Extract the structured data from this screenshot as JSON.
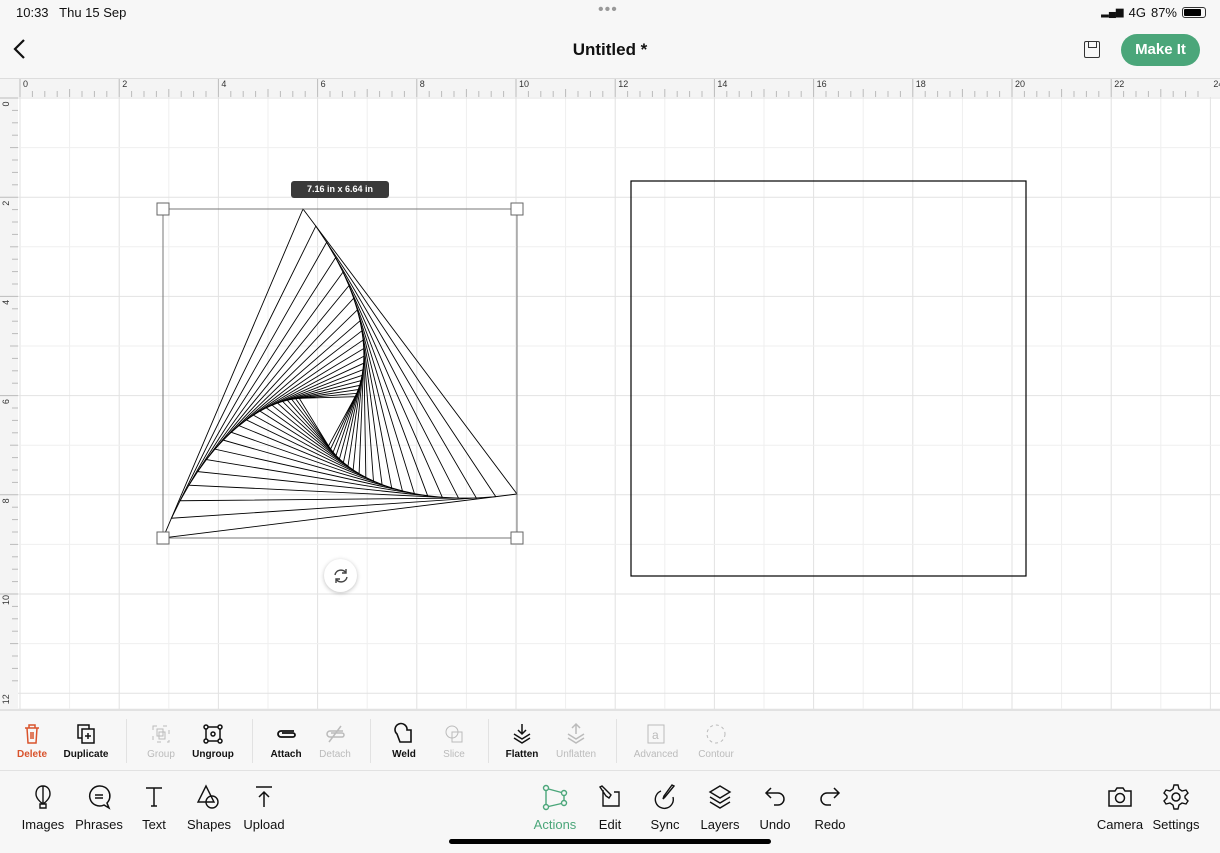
{
  "status_bar": {
    "time": "10:33",
    "date": "Thu 15 Sep",
    "network": "4G",
    "battery": "87%",
    "battery_level": 0.87
  },
  "header": {
    "title": "Untitled *",
    "make_it": "Make It"
  },
  "canvas": {
    "ruler_top": [
      "0",
      "2",
      "4",
      "6",
      "8",
      "10",
      "12",
      "14",
      "16",
      "18",
      "20",
      "22",
      "24"
    ],
    "ruler_left": [
      "0",
      "2",
      "4",
      "6",
      "8",
      "10",
      "12"
    ],
    "selection_size": "7.16 in x 6.64 in"
  },
  "actions_toolbar": [
    {
      "label": "Delete",
      "icon": "trash-icon",
      "state": "danger"
    },
    {
      "label": "Duplicate",
      "icon": "duplicate-icon",
      "state": "enabled"
    },
    {
      "label": "Group",
      "icon": "group-icon",
      "state": "disabled"
    },
    {
      "label": "Ungroup",
      "icon": "ungroup-icon",
      "state": "enabled"
    },
    {
      "label": "Attach",
      "icon": "paperclip-icon",
      "state": "enabled"
    },
    {
      "label": "Detach",
      "icon": "detach-icon",
      "state": "disabled"
    },
    {
      "label": "Weld",
      "icon": "weld-icon",
      "state": "enabled"
    },
    {
      "label": "Slice",
      "icon": "slice-icon",
      "state": "disabled"
    },
    {
      "label": "Flatten",
      "icon": "flatten-icon",
      "state": "enabled"
    },
    {
      "label": "Unflatten",
      "icon": "unflatten-icon",
      "state": "disabled"
    },
    {
      "label": "Advanced",
      "icon": "advanced-icon",
      "state": "disabled"
    },
    {
      "label": "Contour",
      "icon": "contour-icon",
      "state": "disabled"
    }
  ],
  "bottom_bar": [
    {
      "label": "Images",
      "icon": "balloon-icon"
    },
    {
      "label": "Phrases",
      "icon": "speech-bubble-icon"
    },
    {
      "label": "Text",
      "icon": "text-icon"
    },
    {
      "label": "Shapes",
      "icon": "shapes-icon"
    },
    {
      "label": "Upload",
      "icon": "upload-icon"
    },
    {
      "label": "Actions",
      "icon": "actions-icon",
      "active": true
    },
    {
      "label": "Edit",
      "icon": "edit-icon"
    },
    {
      "label": "Sync",
      "icon": "sync-icon"
    },
    {
      "label": "Layers",
      "icon": "layers-icon"
    },
    {
      "label": "Undo",
      "icon": "undo-icon"
    },
    {
      "label": "Redo",
      "icon": "redo-icon"
    },
    {
      "label": "Camera",
      "icon": "camera-icon"
    },
    {
      "label": "Settings",
      "icon": "gear-icon"
    }
  ],
  "colors": {
    "accent": "#4ba67a",
    "danger": "#d9532c"
  }
}
